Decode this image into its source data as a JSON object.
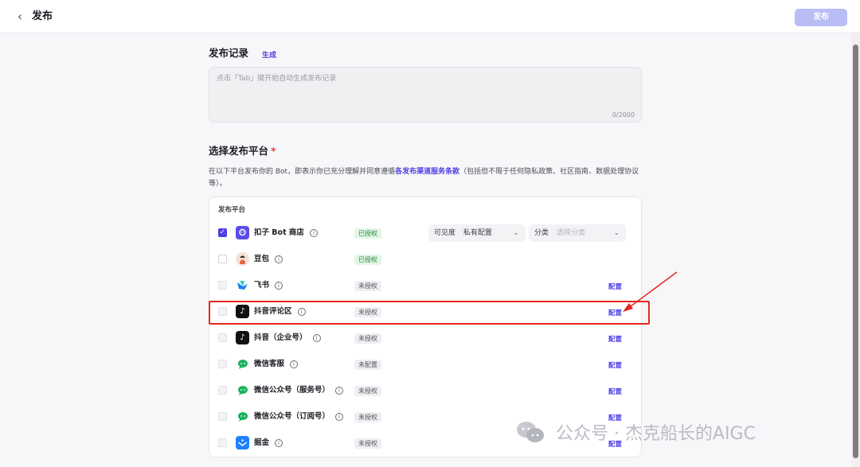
{
  "header": {
    "back_icon": "chevron-left-icon",
    "title": "发布",
    "publish_label": "发布"
  },
  "record": {
    "title": "发布记录",
    "generate_label": "生成",
    "placeholder": "点击「Tab」键开始自动生成发布记录",
    "count": "0/2000"
  },
  "platform_section": {
    "title": "选择发布平台",
    "required_mark": "*",
    "desc_prefix": "在以下平台发布你的 Bot，即表示你已充分理解并同意遵循",
    "desc_link": "各发布渠道服务条款",
    "desc_suffix": "（包括但不限于任何隐私政策、社区指南、数据处理协议等）。",
    "column_header": "发布平台"
  },
  "store_row": {
    "visibility_label": "可见度",
    "visibility_value": "私有配置",
    "category_label": "分类",
    "category_placeholder": "选择分类"
  },
  "platforms": [
    {
      "name": "扣子 Bot 商店",
      "status": "已授权",
      "config": "",
      "checked": true,
      "icon": "coze-store-icon"
    },
    {
      "name": "豆包",
      "status": "已授权",
      "config": "",
      "checked": false,
      "icon": "doubao-avatar-icon"
    },
    {
      "name": "飞书",
      "status": "未授权",
      "config": "配置",
      "checked": false,
      "icon": "feishu-icon"
    },
    {
      "name": "抖音评论区",
      "status": "未授权",
      "config": "配置",
      "checked": false,
      "icon": "douyin-icon"
    },
    {
      "name": "抖音（企业号）",
      "status": "未授权",
      "config": "配置",
      "checked": false,
      "icon": "douyin-icon"
    },
    {
      "name": "微信客服",
      "status": "未配置",
      "config": "配置",
      "checked": false,
      "icon": "wechat-icon"
    },
    {
      "name": "微信公众号（服务号）",
      "status": "未授权",
      "config": "配置",
      "checked": false,
      "icon": "wechat-icon"
    },
    {
      "name": "微信公众号（订阅号）",
      "status": "未授权",
      "config": "配置",
      "checked": false,
      "icon": "wechat-icon"
    },
    {
      "name": "掘金",
      "status": "未授权",
      "config": "配置",
      "checked": false,
      "icon": "juejin-icon"
    }
  ],
  "watermark": {
    "text": "公众号 · 杰克船长的AIGC"
  },
  "colors": {
    "accent": "#4e40e5",
    "authorized_bg": "#e3f6e6",
    "highlight": "#e5261d"
  }
}
